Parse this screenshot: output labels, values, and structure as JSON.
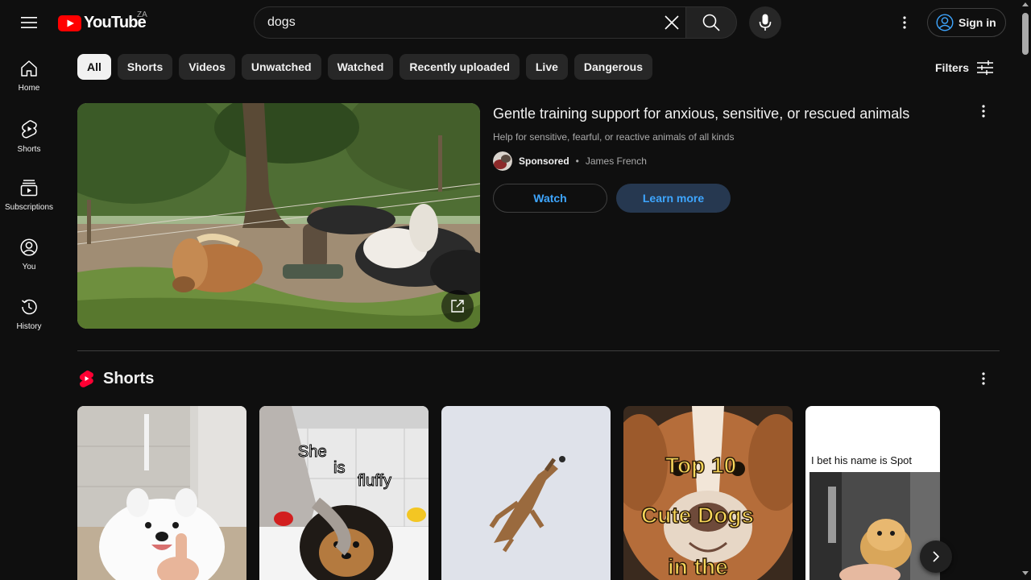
{
  "header": {
    "logo_text": "YouTube",
    "country_code": "ZA",
    "search_value": "dogs",
    "signin_label": "Sign in",
    "icons": [
      "menu-icon",
      "youtube-logo-icon",
      "clear-icon",
      "search-icon",
      "mic-icon",
      "more-vert-icon",
      "account-icon"
    ]
  },
  "sidebar": {
    "items": [
      {
        "label": "Home",
        "icon": "home-icon"
      },
      {
        "label": "Shorts",
        "icon": "shorts-icon"
      },
      {
        "label": "Subscriptions",
        "icon": "subscriptions-icon"
      },
      {
        "label": "You",
        "icon": "you-icon"
      },
      {
        "label": "History",
        "icon": "history-icon"
      }
    ]
  },
  "chips": {
    "items": [
      "All",
      "Shorts",
      "Videos",
      "Unwatched",
      "Watched",
      "Recently uploaded",
      "Live",
      "Dangerous"
    ],
    "selected": "All"
  },
  "filters": {
    "label": "Filters",
    "icon": "tune-icon"
  },
  "ad": {
    "title": "Gentle training support for anxious, sensitive, or rescued animals",
    "description": "Help for sensitive, fearful, or reactive animals of all kinds",
    "sponsored_label": "Sponsored",
    "separator": "•",
    "advertiser": "James French",
    "watch_label": "Watch",
    "learn_more_label": "Learn more",
    "thumbnail": "horses lying on the ground with a man in a paddock",
    "icons": [
      "external-link-icon",
      "more-vert-icon"
    ]
  },
  "shorts_section": {
    "title": "Shorts",
    "items": [
      {
        "thumbnail": "white fluffy dog",
        "overlay": ""
      },
      {
        "thumbnail": "pomeranian in bath",
        "overlay": [
          "She",
          "is",
          "fluffy"
        ]
      },
      {
        "thumbnail": "dog jumping for ball",
        "overlay": ""
      },
      {
        "thumbnail": "puppy close-up",
        "overlay": [
          "Top 10",
          "Cute Dogs",
          "in the"
        ]
      },
      {
        "thumbnail": "golden retriever puppy",
        "overlay": "I bet his name is Spot"
      }
    ]
  },
  "colors": {
    "background": "#0f0f0f",
    "brand_red": "#ff0000",
    "link_blue": "#3ea6ff",
    "chip_bg": "#272727",
    "learn_bg": "#263850"
  }
}
